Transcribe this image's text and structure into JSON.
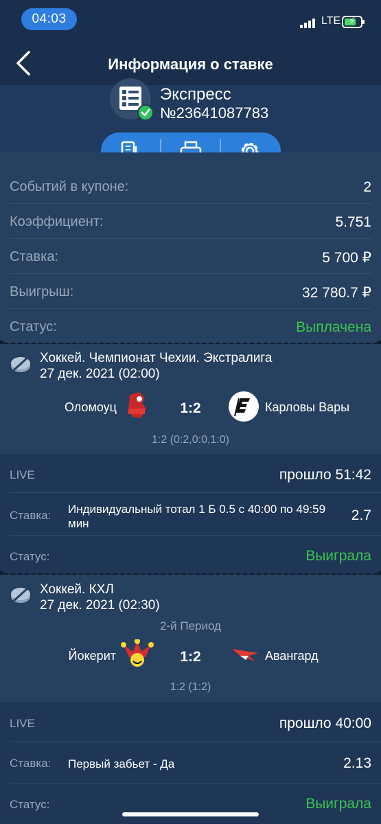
{
  "status_bar": {
    "time": "04:03",
    "network": "LTE"
  },
  "nav": {
    "title": "Информация о ставке"
  },
  "coupon": {
    "type": "Экспресс",
    "number": "№23641087783"
  },
  "summary": [
    {
      "label": "Событий в купоне:",
      "value": "2"
    },
    {
      "label": "Коэффициент:",
      "value": "5.751"
    },
    {
      "label": "Ставка:",
      "value": "5 700 ₽"
    },
    {
      "label": "Выигрыш:",
      "value": "32 780.7 ₽"
    },
    {
      "label": "Статус:",
      "value": "Выплачена"
    }
  ],
  "events": [
    {
      "title": "Хоккей. Чемпионат Чехии. Экстралига",
      "date": "27 дек. 2021 (02:00)",
      "home": "Оломоуц",
      "away": "Карловы Вары",
      "score": "1:2",
      "periods": "1:2 (0:2,0:0,1:0)",
      "live": "LIVE",
      "elapsed": "прошло 51:42",
      "stake_label": "Ставка:",
      "stake": "Индивидуальный тотал 1 Б 0.5 с 40:00 по 49:59 мин",
      "odds": "2.7",
      "status_label": "Статус:",
      "status": "Выиграла"
    },
    {
      "title": "Хоккей. КХЛ",
      "date": "27 дек. 2021 (02:30)",
      "period": "2-й Период",
      "home": "Йокерит",
      "away": "Авангард",
      "score": "1:2",
      "periods": "1:2 (1:2)",
      "live": "LIVE",
      "elapsed": "прошло 40:00",
      "stake_label": "Ставка:",
      "stake": "Первый забьет - Да",
      "odds": "2.13",
      "status_label": "Статус:",
      "status": "Выиграла"
    }
  ],
  "colors": {
    "accent": "#2d7fdc",
    "success": "#3dc24f",
    "background": "#1d3352"
  }
}
